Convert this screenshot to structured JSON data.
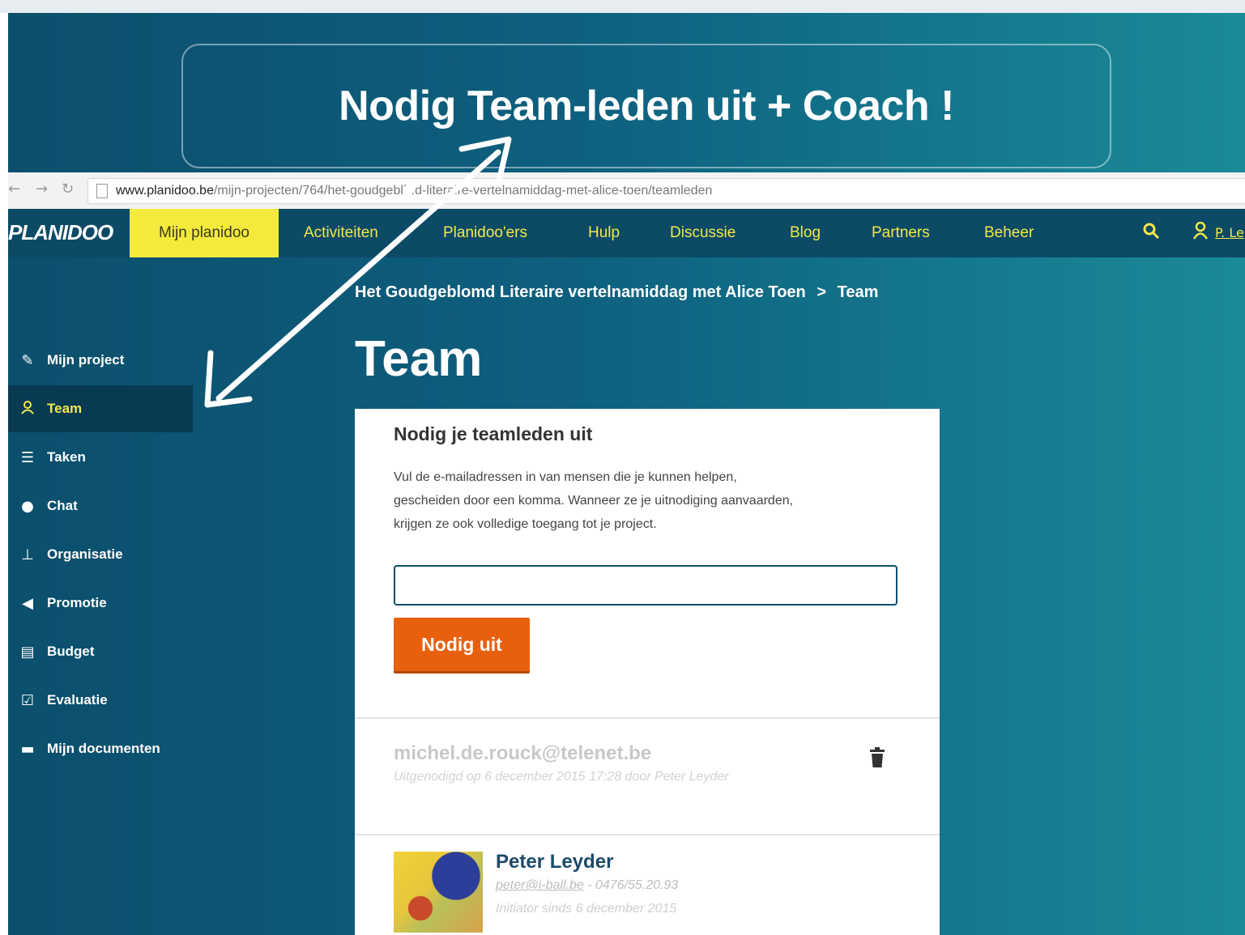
{
  "callout": {
    "text": "Nodig Team-leden uit + Coach !"
  },
  "browser": {
    "url_domain": "www.planidoo.be",
    "url_path": "/mijn-projecten/764/het-goudgebl´ .d-literaire-vertelnamiddag-met-alice-toen/teamleden"
  },
  "navbar": {
    "logo": "PLANIDOO",
    "items": [
      {
        "label": "Mijn planidoo",
        "active": true
      },
      {
        "label": "Activiteiten"
      },
      {
        "label": "Planidoo'ers"
      },
      {
        "label": "Hulp"
      },
      {
        "label": "Discussie"
      },
      {
        "label": "Blog"
      },
      {
        "label": "Partners"
      },
      {
        "label": "Beheer"
      }
    ],
    "user_label": "P. Le"
  },
  "sidebar": {
    "items": [
      {
        "label": "Mijn project",
        "icon": "pen-icon"
      },
      {
        "label": "Team",
        "icon": "team-icon",
        "active": true
      },
      {
        "label": "Taken",
        "icon": "list-icon"
      },
      {
        "label": "Chat",
        "icon": "chat-icon"
      },
      {
        "label": "Organisatie",
        "icon": "org-icon"
      },
      {
        "label": "Promotie",
        "icon": "megaphone-icon"
      },
      {
        "label": "Budget",
        "icon": "budget-icon"
      },
      {
        "label": "Evaluatie",
        "icon": "checkbox-icon"
      },
      {
        "label": "Mijn documenten",
        "icon": "folder-icon"
      }
    ]
  },
  "breadcrumb": {
    "project": "Het Goudgeblomd Literaire vertelnamiddag met Alice Toen",
    "sep": ">",
    "current": "Team"
  },
  "page_title": "Team",
  "invite": {
    "title": "Nodig je teamleden uit",
    "desc_lines": [
      "Vul de e-mailadressen in van mensen die je kunnen helpen,",
      "gescheiden door een komma. Wanneer ze je uitnodiging aanvaarden,",
      "krijgen ze ook volledige toegang tot je project."
    ],
    "email_value": "",
    "button_label": "Nodig uit"
  },
  "pending": {
    "email": "michel.de.rouck@telenet.be",
    "meta": "Uitgenodigd op 6 december 2015 17:28 door Peter Leyder"
  },
  "member": {
    "name": "Peter Leyder",
    "email": "peter@i-ball.be",
    "phone": "- 0476/55.20.93",
    "since": "Initiator sinds 6 december 2015"
  },
  "colors": {
    "navbar": "#0c4a66",
    "nav_text": "#f2e84a",
    "nav_active_bg": "#f4ea3c",
    "invite_button": "#e8600e",
    "member_name": "#1c4a6a"
  }
}
